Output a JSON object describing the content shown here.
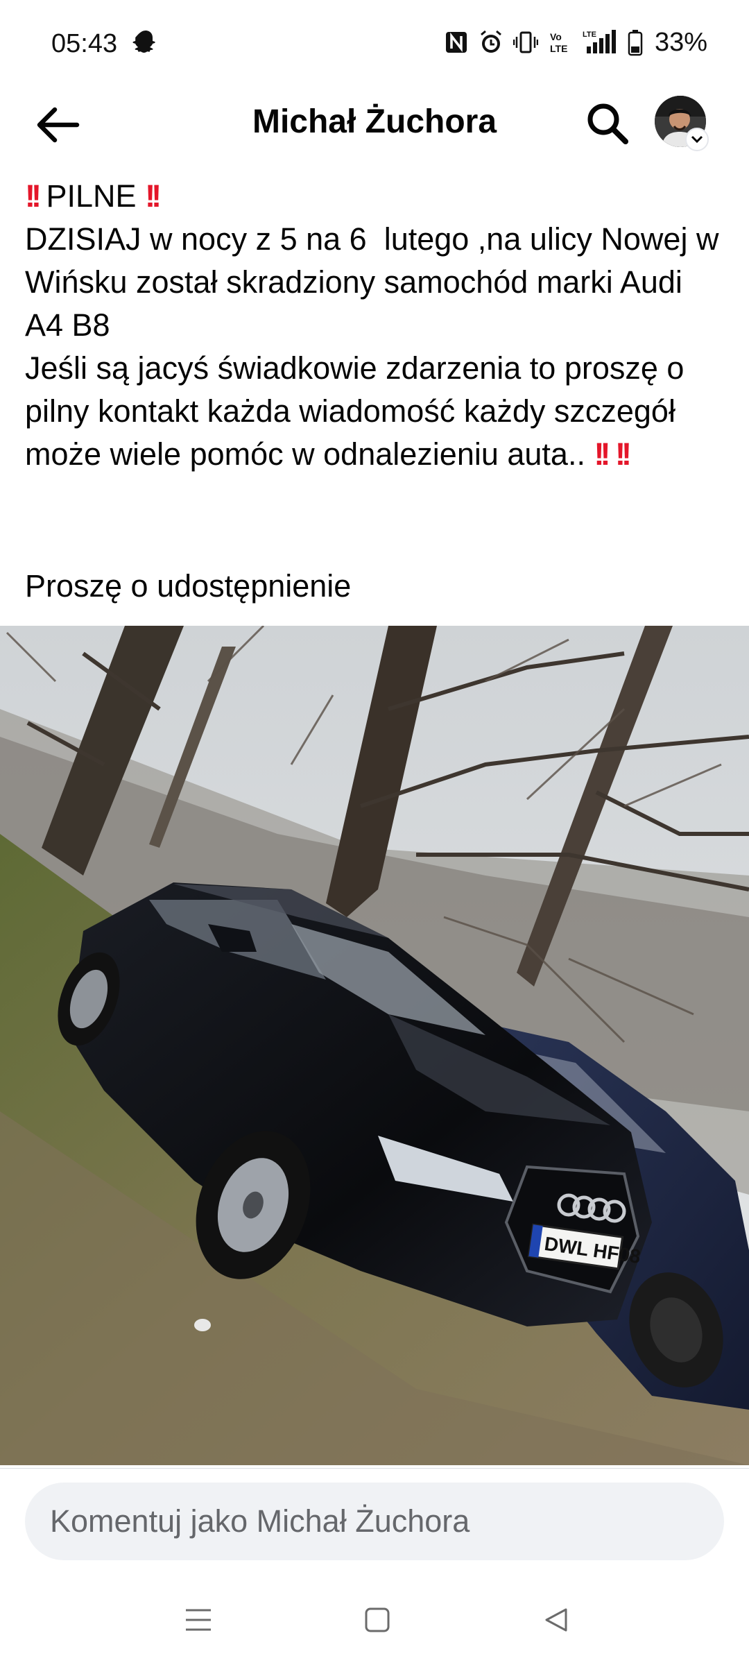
{
  "status_bar": {
    "time": "05:43",
    "battery_percent": "33%",
    "icons": [
      "snapchat-icon",
      "nfc-icon",
      "alarm-icon",
      "vibrate-icon",
      "volte-icon",
      "lte-signal-icon",
      "battery-icon"
    ]
  },
  "header": {
    "title": "Michał Żuchora",
    "back_icon": "arrow-left-icon",
    "search_icon": "search-icon"
  },
  "post": {
    "urgent": "PILNE",
    "body_lines": [
      "DZISIAJ w nocy z 5 na 6  lutego ,na ulicy Nowej w Wińsku został skradziony samochód marki Audi A4 B8",
      "Jeśli są jacyś świadkowie zdarzenia to proszę o pilny kontakt każda wiadomość każdy szczegół może wiele pomóc w odnalezieniu auta.. "
    ],
    "share_request": "Proszę o udostępnienie",
    "photo": {
      "plate": "DWL HF08"
    }
  },
  "comment": {
    "placeholder": "Komentuj jako Michał Żuchora"
  },
  "colors": {
    "accent_red": "#e4162a",
    "input_bg": "#f0f2f5",
    "placeholder": "#65676b"
  }
}
